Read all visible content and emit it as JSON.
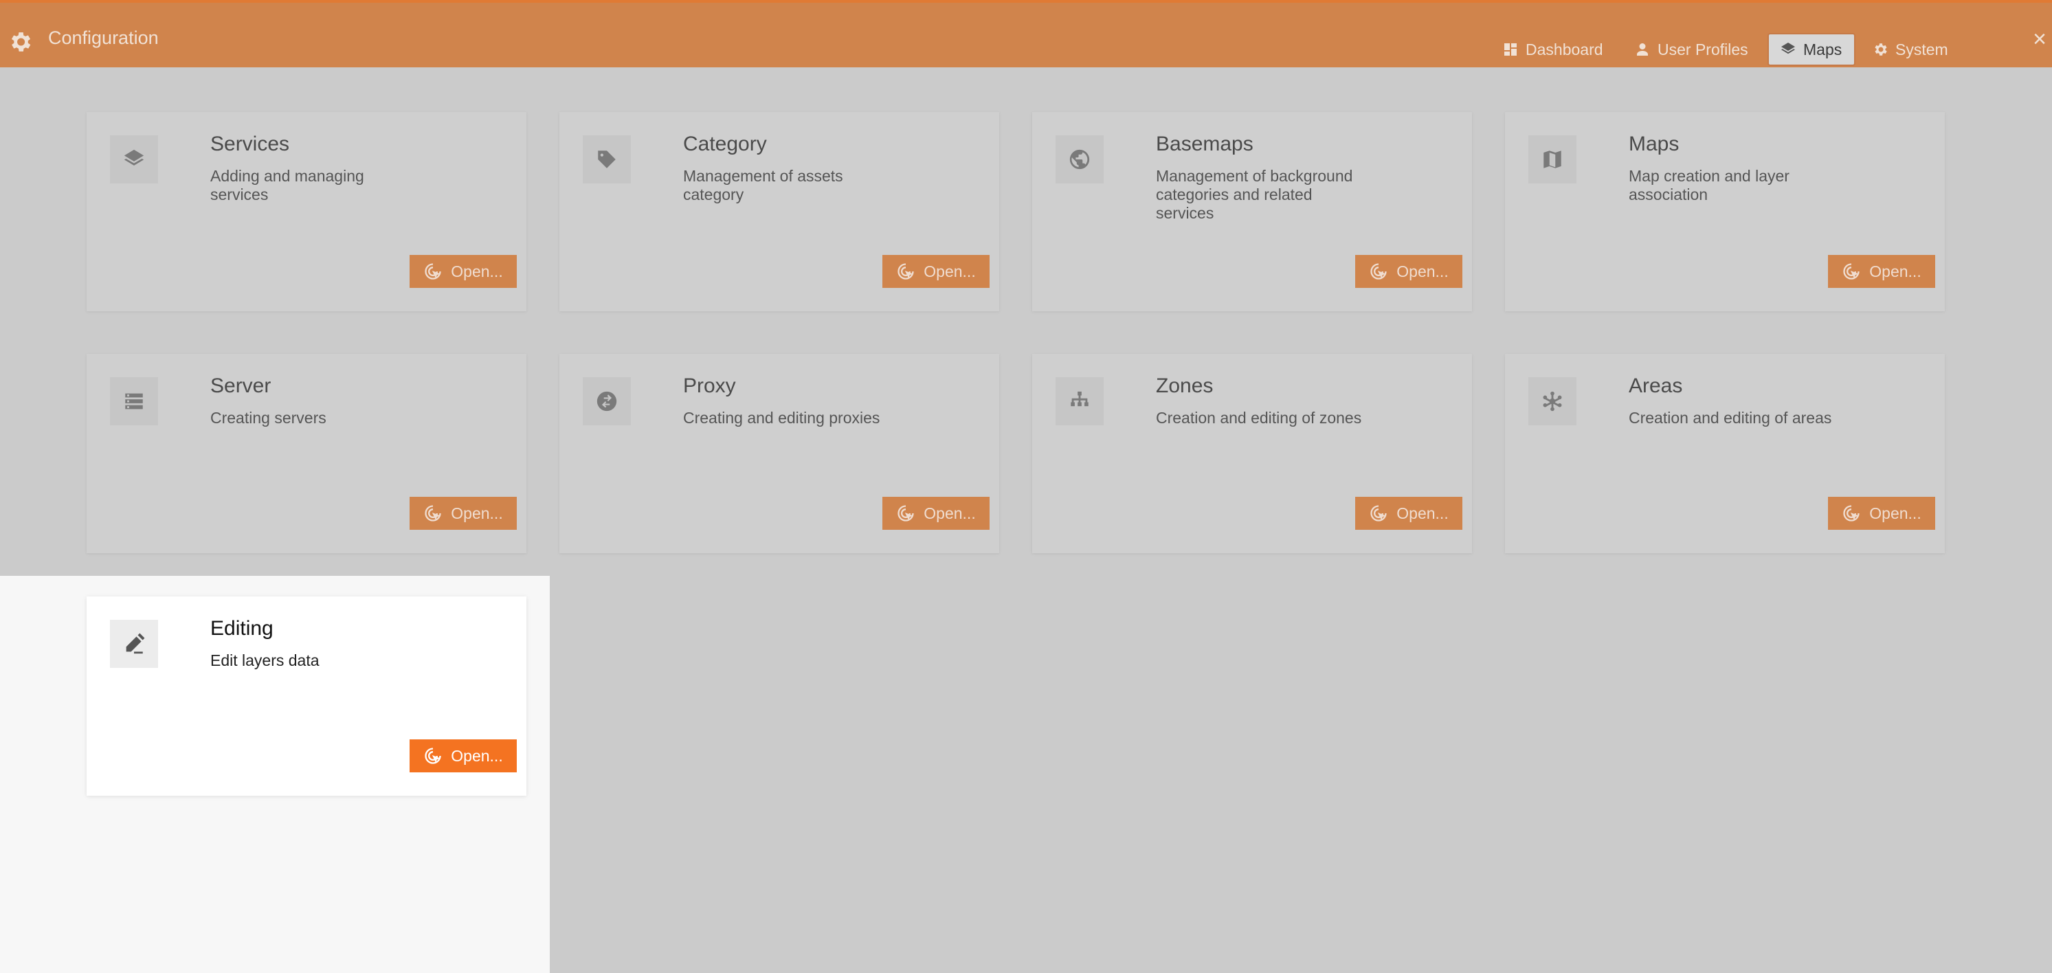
{
  "header": {
    "title": "Configuration",
    "app_icon": "gear-icon",
    "nav": [
      {
        "label": "Dashboard",
        "icon": "dashboard-icon"
      },
      {
        "label": "User Profiles",
        "icon": "user-icon"
      },
      {
        "label": "Maps",
        "icon": "layers-icon",
        "active": true
      },
      {
        "label": "System",
        "icon": "gear-icon"
      }
    ],
    "close_glyph": "×"
  },
  "cards": [
    {
      "title": "Services",
      "description": "Adding and managing services",
      "icon": "layers-icon",
      "button": "Open..."
    },
    {
      "title": "Category",
      "description": "Management of assets category",
      "icon": "tag-icon",
      "button": "Open..."
    },
    {
      "title": "Basemaps",
      "description": "Management of background categories and related services",
      "icon": "globe-icon",
      "button": "Open..."
    },
    {
      "title": "Maps",
      "description": "Map creation and layer association",
      "icon": "map-icon",
      "button": "Open..."
    },
    {
      "title": "Server",
      "description": "Creating servers",
      "icon": "server-icon",
      "button": "Open..."
    },
    {
      "title": "Proxy",
      "description": "Creating and editing proxies",
      "icon": "proxy-icon",
      "button": "Open..."
    },
    {
      "title": "Zones",
      "description": "Creation and editing of zones",
      "icon": "hierarchy-icon",
      "button": "Open..."
    },
    {
      "title": "Areas",
      "description": "Creation and editing of areas",
      "icon": "hub-icon",
      "button": "Open..."
    },
    {
      "title": "Editing",
      "description": "Edit layers data",
      "icon": "edit-icon",
      "button": "Open...",
      "highlighted": true
    }
  ],
  "colors": {
    "header": "#d0844c",
    "accent": "#f47321",
    "backdrop": "#cbcbcb"
  }
}
